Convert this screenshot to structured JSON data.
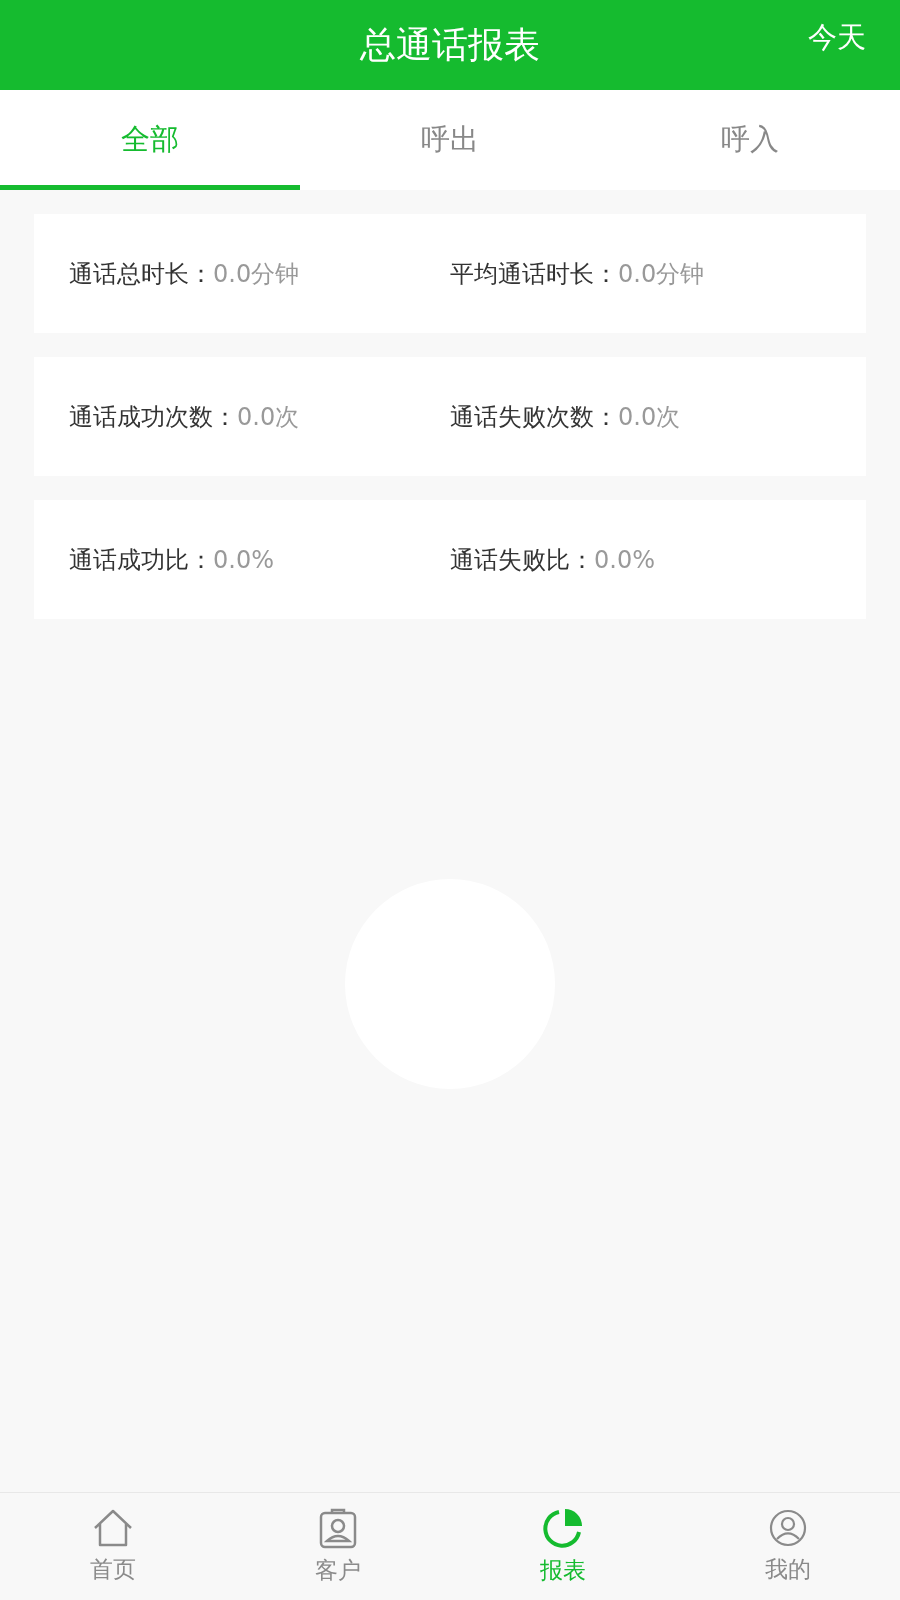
{
  "header": {
    "title": "总通话报表",
    "action": "今天"
  },
  "tabs": [
    {
      "label": "全部",
      "selected": true
    },
    {
      "label": "呼出",
      "selected": false
    },
    {
      "label": "呼入",
      "selected": false
    }
  ],
  "stat_cards": [
    {
      "stats": [
        {
          "label": "通话总时长：",
          "value": "0.0分钟"
        },
        {
          "label": "平均通话时长：",
          "value": "0.0分钟"
        }
      ]
    },
    {
      "stats": [
        {
          "label": "通话成功次数：",
          "value": "0.0次"
        },
        {
          "label": "通话失败次数：",
          "value": "0.0次"
        }
      ]
    },
    {
      "stats": [
        {
          "label": "通话成功比：",
          "value": "0.0%"
        },
        {
          "label": "通话失败比：",
          "value": "0.0%"
        }
      ]
    }
  ],
  "bottom_nav": [
    {
      "kind": "home",
      "label": "首页",
      "selected": false
    },
    {
      "kind": "contact",
      "label": "客户",
      "selected": false
    },
    {
      "kind": "report",
      "label": "报表",
      "selected": true
    },
    {
      "kind": "profile",
      "label": "我的",
      "selected": false
    }
  ]
}
